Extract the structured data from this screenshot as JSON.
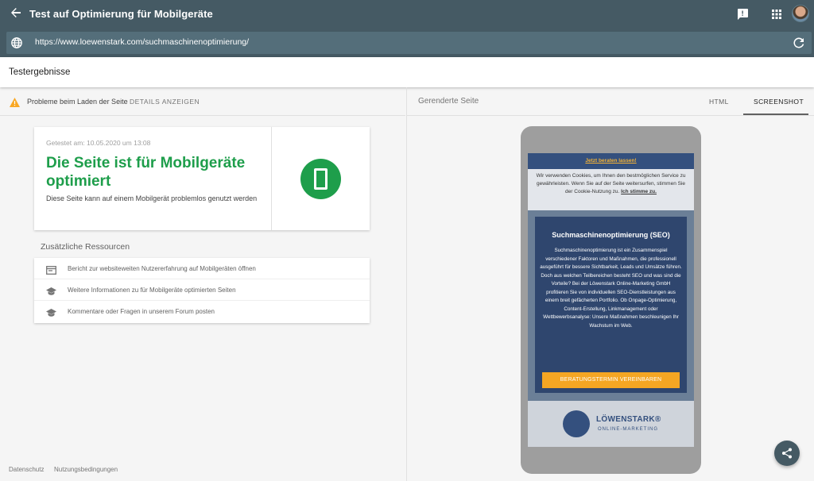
{
  "app": {
    "title": "Test auf Optimierung für Mobilgeräte",
    "url": "https://www.loewenstark.com/suchmaschinenoptimierung/"
  },
  "results": {
    "title": "Testergebnisse"
  },
  "issues": {
    "text": "Probleme beim Laden der Seite",
    "details_link": "DETAILS ANZEIGEN"
  },
  "result_card": {
    "tested": "Getestet am: 10.05.2020 um 13:08",
    "verdict": "Die Seite ist für Mobilgeräte optimiert",
    "subtext": "Diese Seite kann auf einem Mobilgerät problemlos genutzt werden",
    "status_color": "#1e9e4b"
  },
  "resources": {
    "heading": "Zusätzliche Ressourcen",
    "items": [
      {
        "label": "Bericht zur websiteweiten Nutzererfahrung auf Mobilgeräten öffnen",
        "icon": "report-icon"
      },
      {
        "label": "Weitere Informationen zu für Mobilgeräte optimierten Seiten",
        "icon": "school-icon"
      },
      {
        "label": "Kommentare oder Fragen in unserem Forum posten",
        "icon": "school-icon"
      }
    ]
  },
  "footer": {
    "privacy": "Datenschutz",
    "terms": "Nutzungsbedingungen"
  },
  "right_panel": {
    "label": "Gerenderte Seite",
    "tabs": [
      "HTML",
      "SCREENSHOT"
    ],
    "active_tab": "SCREENSHOT"
  },
  "rendered_page": {
    "top_cta": "Jetzt beraten lassen!",
    "cookie_text": "Wir verwenden Cookies, um Ihnen den bestmöglichen Service zu gewährleisten. Wenn Sie auf der Seite weitersurfen, stimmen Sie der Cookie-Nutzung zu.",
    "cookie_accept": "Ich stimme zu.",
    "hero_title": "Suchmaschinenoptimierung (SEO)",
    "hero_text": "Suchmaschinenoptimierung ist ein Zusammenspiel verschiedener Faktoren und Maßnahmen, die professionell ausgeführt für bessere Sichtbarkeit, Leads und Umsätze führen. Doch aus welchen Teilbereichen besteht SEO und was sind die Vorteile? Bei der Löwenstark Online-Marketing GmbH profitieren Sie von individuellen SEO-Dienstleistungen aus einem breit gefächerten Portfolio. Ob Onpage-Optimierung, Content-Erstellung, Linkmanagement oder Wettbewerbsanalyse: Unsere Maßnahmen beschleunigen Ihr Wachstum im Web.",
    "hero_button": "BERATUNGSTERMIN VEREINBAREN",
    "logo_name": "LÖWENSTARK®",
    "logo_tagline": "ONLINE-MARKETING"
  },
  "colors": {
    "header": "#455a64",
    "urlbar": "#546e7a",
    "success": "#1e9e4b",
    "warning": "#f9a825"
  }
}
